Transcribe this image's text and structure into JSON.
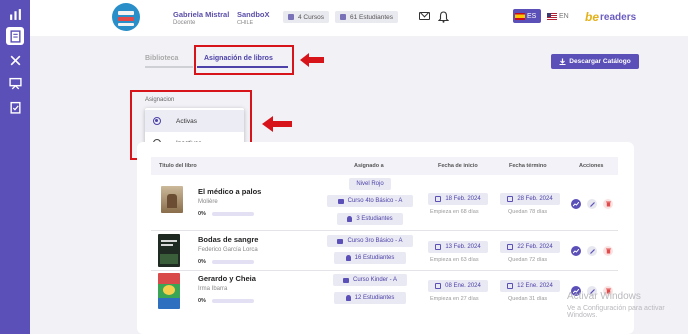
{
  "header": {
    "user_name": "Gabriela Mistral",
    "user_role": "Docente",
    "school_name": "SandboX",
    "school_country": "CHILE",
    "courses_chip": "4 Cursos",
    "students_chip": "61 Estudiantes",
    "lang_es": "ES",
    "lang_en": "EN",
    "logo_be": "be",
    "logo_text": "readers"
  },
  "sidebar": {
    "items": [
      {
        "icon": "bar-chart-icon"
      },
      {
        "icon": "book-icon",
        "active": true
      },
      {
        "icon": "tools-icon"
      },
      {
        "icon": "presentation-icon"
      },
      {
        "icon": "clipboard-check-icon"
      }
    ]
  },
  "tabs": {
    "biblioteca": "Biblioteca",
    "asignacion": "Asignación de libros"
  },
  "download_button": "Descargar Catálogo",
  "filter": {
    "label": "Asignacion",
    "options": [
      "Activas",
      "Inactivas"
    ],
    "selected": "Activas"
  },
  "table": {
    "headers": [
      "Titulo del libro",
      "Asignado a",
      "Fecha de inicio",
      "Fecha término",
      "Acciones"
    ],
    "rows": [
      {
        "title": "El médico a palos",
        "author": "Molière",
        "progress": "0%",
        "progress_fraction": 0,
        "assigned": [
          "Nivel Rojo",
          "Curso 4to Básico - A",
          "3 Estudiantes"
        ],
        "start": "18 Feb. 2024",
        "start_note": "Empieza en 68 días",
        "end": "28 Feb. 2024",
        "end_note": "Quedan 78 días"
      },
      {
        "title": "Bodas de sangre",
        "author": "Federico García Lorca",
        "progress": "0%",
        "progress_fraction": 0,
        "assigned": [
          "Curso 3ro Básico - A",
          "16 Estudiantes"
        ],
        "start": "13 Feb. 2024",
        "start_note": "Empieza en 63 días",
        "end": "22 Feb. 2024",
        "end_note": "Quedan 72 días"
      },
      {
        "title": "Gerardo y Cheia",
        "author": "Irma Ibarra",
        "progress": "0%",
        "progress_fraction": 0,
        "assigned": [
          "Curso Kinder - A",
          "12 Estudiantes"
        ],
        "start": "08 Ene. 2024",
        "start_note": "Empieza en 27 días",
        "end": "12 Ene. 2024",
        "end_note": "Quedan 31 días"
      }
    ]
  },
  "watermark": {
    "line1": "Activar Windows",
    "line2": "Ve a Configuración para activar Windows."
  },
  "colors": {
    "accent": "#5b4fb8",
    "annotation_red": "#d8141b"
  }
}
